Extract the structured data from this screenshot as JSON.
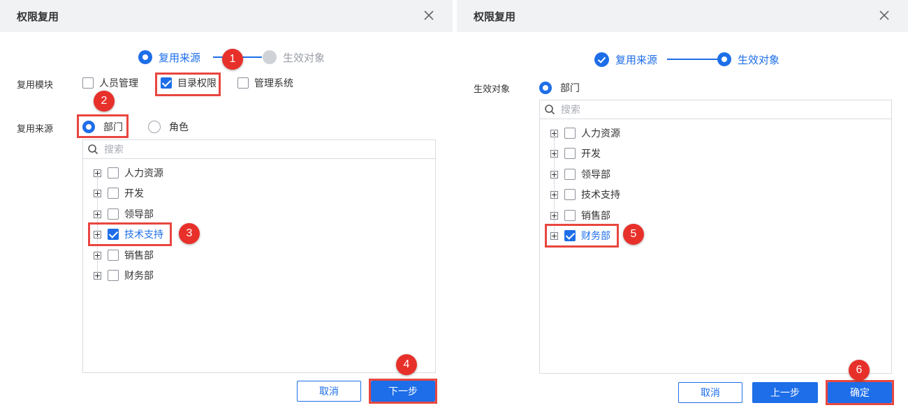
{
  "colors": {
    "accent": "#1d6ee8",
    "marker": "#e8302a",
    "header_bg": "#f1f2f4"
  },
  "left": {
    "title": "权限复用",
    "steps": {
      "step1": "复用来源",
      "step2": "生效对象"
    },
    "module_label": "复用模块",
    "modules": [
      {
        "label": "人员管理",
        "checked": false
      },
      {
        "label": "目录权限",
        "checked": true
      },
      {
        "label": "管理系统",
        "checked": false
      }
    ],
    "source_label": "复用来源",
    "source_options": [
      {
        "label": "部门",
        "selected": true
      },
      {
        "label": "角色",
        "selected": false
      }
    ],
    "search_placeholder": "搜索",
    "tree": [
      {
        "label": "人力资源",
        "checked": false
      },
      {
        "label": "开发",
        "checked": false
      },
      {
        "label": "领导部",
        "checked": false
      },
      {
        "label": "技术支持",
        "checked": true
      },
      {
        "label": "销售部",
        "checked": false
      },
      {
        "label": "财务部",
        "checked": false
      }
    ],
    "cancel_label": "取消",
    "next_label": "下一步"
  },
  "right": {
    "title": "权限复用",
    "steps": {
      "step1": "复用来源",
      "step2": "生效对象"
    },
    "target_label": "生效对象",
    "target_option": "部门",
    "search_placeholder": "搜索",
    "tree": [
      {
        "label": "人力资源",
        "checked": false
      },
      {
        "label": "开发",
        "checked": false
      },
      {
        "label": "领导部",
        "checked": false
      },
      {
        "label": "技术支持",
        "checked": false
      },
      {
        "label": "销售部",
        "checked": false
      },
      {
        "label": "财务部",
        "checked": true
      }
    ],
    "cancel_label": "取消",
    "prev_label": "上一步",
    "confirm_label": "确定"
  },
  "markers": [
    "1",
    "2",
    "3",
    "4",
    "5",
    "6"
  ]
}
